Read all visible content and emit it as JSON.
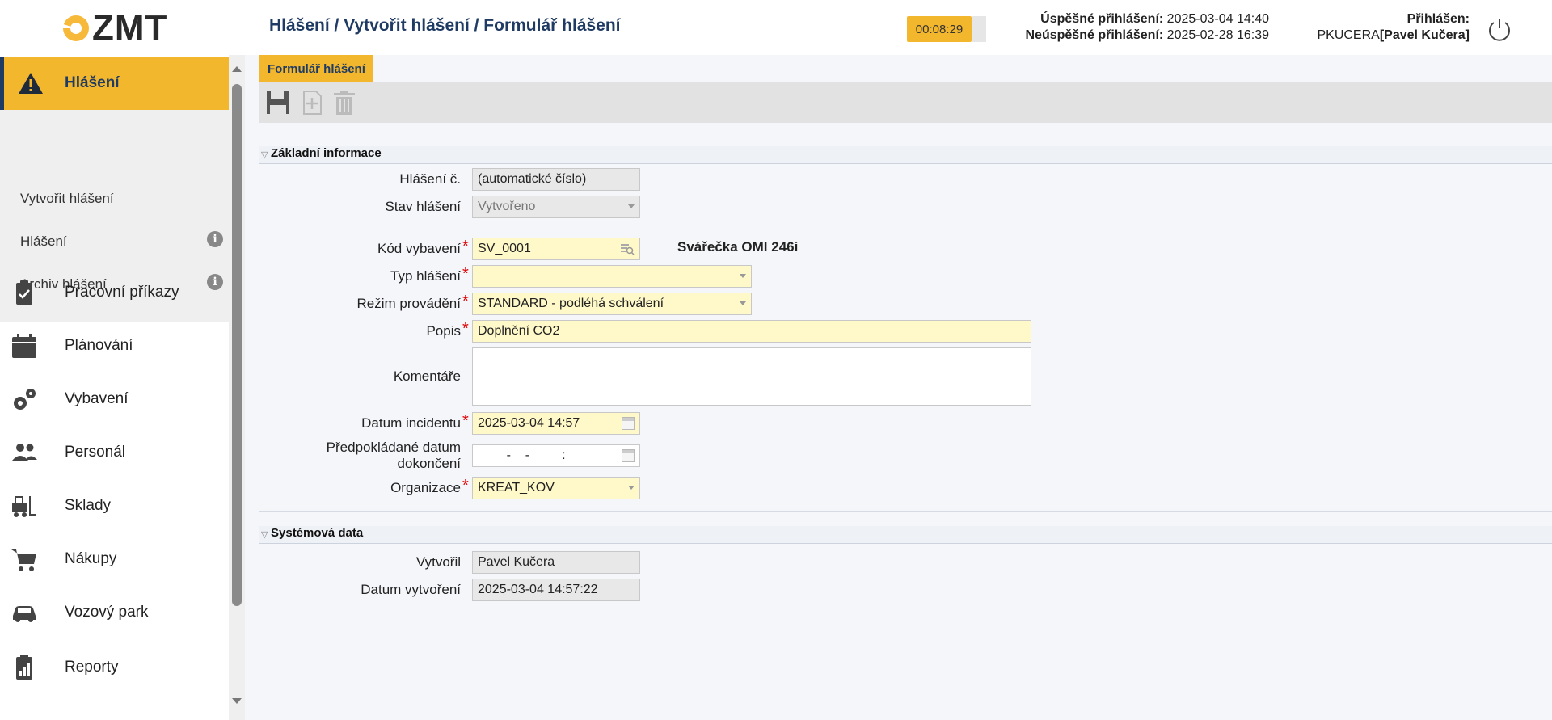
{
  "header": {
    "logo_text": "ZMT",
    "breadcrumb": "Hlášení / Vytvořit hlášení / Formulář hlášení",
    "session_timer": "00:08:29",
    "login_success_label": "Úspěšné přihlášení:",
    "login_success_value": "2025-03-04 14:40",
    "login_fail_label": "Neúspěšné přihlášení:",
    "login_fail_value": "2025-02-28 16:39",
    "logged_in_label": "Přihlášen:",
    "logged_in_user_id": "PKUCERA",
    "logged_in_user_name": "[Pavel Kučera]",
    "accent_color": "#f3b72e",
    "brand_color": "#1f3b63"
  },
  "sidebar": {
    "active": {
      "label": "Hlášení",
      "icon": "warning-icon"
    },
    "subitems": [
      {
        "label": "Vytvořit hlášení"
      },
      {
        "label": "Hlášení",
        "icon": "info-icon"
      },
      {
        "label": "Archiv hlášení",
        "icon": "info-icon"
      }
    ],
    "info_glyph": "i",
    "items": [
      {
        "label": "Pracovní příkazy",
        "icon": "clipboard-check-icon"
      },
      {
        "label": "Plánování",
        "icon": "calendar-icon"
      },
      {
        "label": "Vybavení",
        "icon": "gears-icon"
      },
      {
        "label": "Personál",
        "icon": "users-icon"
      },
      {
        "label": "Sklady",
        "icon": "forklift-icon"
      },
      {
        "label": "Nákupy",
        "icon": "cart-icon"
      },
      {
        "label": "Vozový park",
        "icon": "car-icon"
      },
      {
        "label": "Reporty",
        "icon": "report-icon"
      }
    ]
  },
  "main": {
    "tab_label": "Formulář hlášení",
    "toolbar": {
      "icons": [
        "save-icon",
        "add-icon",
        "delete-icon"
      ]
    },
    "section_basic": {
      "title": "Základní informace",
      "report_no_label": "Hlášení č.",
      "report_no_value": "(automatické číslo)",
      "state_label": "Stav hlášení",
      "state_value": "Vytvořeno",
      "equipment_code_label": "Kód vybavení",
      "equipment_code_value": "SV_0001",
      "equipment_name": "Svářečka OMI 246i",
      "report_type_label": "Typ hlášení",
      "report_type_value": "",
      "mode_label": "Režim provádění",
      "mode_value": "STANDARD - podléhá schválení",
      "description_label": "Popis",
      "description_value": "Doplnění CO2",
      "comments_label": "Komentáře",
      "comments_value": "",
      "incident_date_label": "Datum incidentu",
      "incident_date_value": "2025-03-04 14:57",
      "expected_completion_label_1": "Předpokládané datum",
      "expected_completion_label_2": "dokončení",
      "expected_completion_placeholder": "____-__-__ __:__",
      "organization_label": "Organizace",
      "organization_value": "KREAT_KOV",
      "required_mark": "*"
    },
    "section_system": {
      "title": "Systémová data",
      "created_by_label": "Vytvořil",
      "created_by_value": "Pavel Kučera",
      "created_date_label": "Datum vytvoření",
      "created_date_value": "2025-03-04 14:57:22"
    }
  }
}
